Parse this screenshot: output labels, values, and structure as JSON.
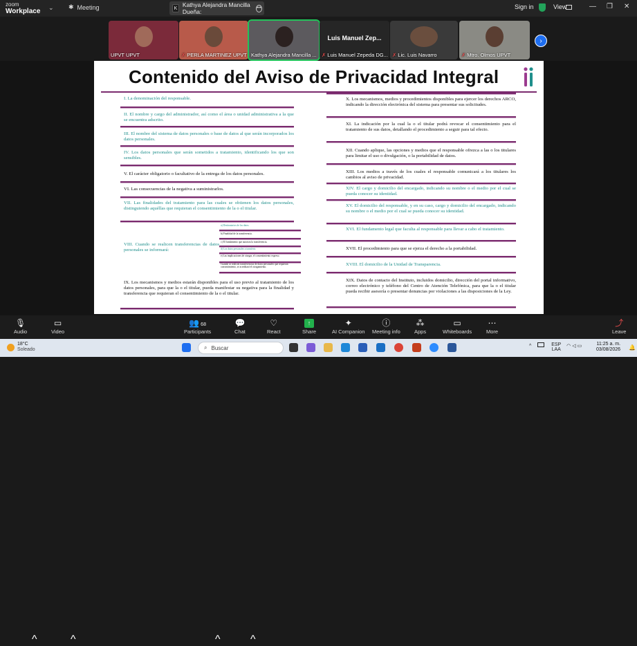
{
  "titlebar": {
    "brand_line1": "zoom",
    "brand_line2": "Workplace",
    "meeting_label": "Meeting",
    "tab_initial": "K",
    "tab_title": "Kathya Alejandra Mancilla Dueña:",
    "signin": "Sign in",
    "view": "View"
  },
  "gallery": {
    "tiles": [
      {
        "name": "UPVT UPVT",
        "muted": false
      },
      {
        "name": "PERLA MARTINEZ UPVT",
        "muted": true
      },
      {
        "name": "Kathya Alejandra Mancilla ...",
        "muted": false,
        "active": true
      },
      {
        "big_name": "Luis  Manuel  Zep...",
        "name": "Luis Manuel Zepeda DG...",
        "muted": true
      },
      {
        "name": "Lic. Luis Navarro",
        "muted": true
      },
      {
        "name": "Mtro. Olmos UPVT",
        "muted": true
      }
    ]
  },
  "slide": {
    "title": "Contenido del Aviso de Privacidad Integral",
    "left_items": [
      {
        "text": "I. La denominación del responsable.",
        "color": "teal"
      },
      {
        "text": "II. El nombre y cargo del administrador, así como el área o unidad administrativa a la que se encuentra adscrito.",
        "color": "teal"
      },
      {
        "text": "III. El nombre del sistema de datos personales o base de datos al que serán incorporados los datos personales.",
        "color": "teal"
      },
      {
        "text": "IV. Los datos personales que serán sometidos a tratamiento, identificando los que son sensibles.",
        "color": "teal"
      },
      {
        "text": "V. El carácter obligatorio o facultativo de la entrega de los datos personales.",
        "color": "blk"
      },
      {
        "text": "VI. Las consecuencias de la negativa a suministrarlos.",
        "color": "blk"
      },
      {
        "text": "VII. Las finalidades del tratamiento para las cuales se obtienen los datos personales, distinguiendo aquéllas que requieran el consentimiento de la o el titular.",
        "color": "teal"
      },
      {
        "text": "VIII. Cuando se realicen transferencias de datos personales se informará:",
        "color": "teal"
      },
      {
        "text": "IX. Los mecanismos y medios estarán disponibles para el uso previo al tratamiento de los datos personales, para que la o el titular, pueda manifestar su negativa para la finalidad y transferencia que requieran el consentimiento de la o el titular.",
        "color": "blk"
      }
    ],
    "sub_items": [
      "a) Destinatarios de los datos.",
      "b) Finalidad de la transferencia.",
      "c) El fundamento que autoriza la transferencia.",
      "d) Los datos personales a transferir.",
      "e) Las implicaciones de otorgar, el consentimiento expreso.",
      "Cuando se realicen transferencias de datos personales que requieran consentimiento, se acreditará el otorgamiento."
    ],
    "right_items": [
      {
        "text": "X. Los mecanismos, medios y procedimientos disponibles para ejercer los derechos ARCO, indicando la dirección electrónica del sistema para presentar sus solicitudes.",
        "color": "blk"
      },
      {
        "text": "XI. La indicación por la cual la o el titular podrá revocar el consentimiento para el tratamiento de sus datos, detallando el procedimiento a seguir para tal efecto.",
        "color": "blk"
      },
      {
        "text": "XII. Cuando aplique, las opciones y medios que el responsable ofrezca a las o los titulares para limitar el uso o divulgación, o la portabilidad de datos.",
        "color": "blk"
      },
      {
        "text": "XIII. Los medios a través de los cuales el responsable comunicará a los titulares los cambios al aviso de privacidad.",
        "color": "blk"
      },
      {
        "text": "XIV. El cargo y domicilio del encargado, indicando su nombre o el medio por el cual se pueda conocer su identidad.",
        "color": "teal"
      },
      {
        "text": "XV. El domicilio del responsable, y en su caso, cargo y domicilio del encargado, indicando su nombre o el medio por el cual se pueda conocer su identidad.",
        "color": "teal"
      },
      {
        "text": "XVI. El fundamento legal que faculta al responsable para llevar a cabo el tratamiento.",
        "color": "teal"
      },
      {
        "text": "XVII. El procedimiento para que se ejerza el derecho a la portabilidad.",
        "color": "blk"
      },
      {
        "text": "XVIII. El domicilio de la Unidad de Transparencia.",
        "color": "teal"
      },
      {
        "text": "XIX. Datos de contacto del Instituto, incluidos domicilio, dirección del portal informativo, correo electrónico y teléfono del Centro de Atención Telefónica, para que la o el titular pueda recibir asesoría o presentar denuncias por violaciones a las disposiciones de la Ley.",
        "color": "blk"
      }
    ]
  },
  "toolbar": {
    "audio": "Audio",
    "video": "Video",
    "participants": "Participants",
    "participants_count": "68",
    "chat": "Chat",
    "react": "React",
    "share": "Share",
    "ai_companion": "AI Companion",
    "meeting_info": "Meeting info",
    "apps": "Apps",
    "whiteboards": "Whiteboards",
    "more": "More",
    "leave": "Leave"
  },
  "taskbar": {
    "temp": "18°C",
    "weather": "Soleado",
    "search_placeholder": "Buscar",
    "lang1": "ESP",
    "lang2": "LAA",
    "time": "11:25 a. m.",
    "date": "03/08/2026"
  },
  "colors": {
    "accent_teal": "#1f8f8c",
    "divider_purple": "#7a2a6e",
    "share_green": "#22b14c",
    "zoom_blue": "#1e6ef0"
  }
}
